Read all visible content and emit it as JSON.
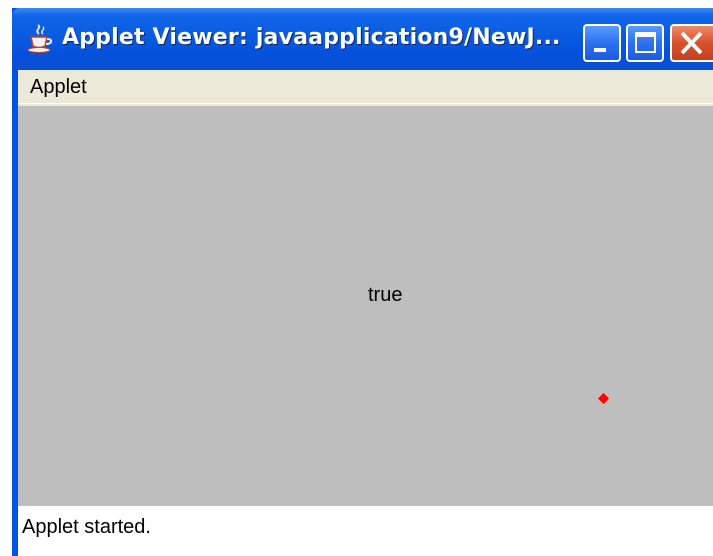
{
  "window": {
    "title": "Applet Viewer: javaapplication9/NewJ...",
    "icon": "java-cup-icon",
    "controls": {
      "minimize": "minimize-icon",
      "maximize": "maximize-icon",
      "close": "close-icon"
    }
  },
  "menubar": {
    "items": [
      {
        "label": "Applet"
      }
    ]
  },
  "applet": {
    "text": "true",
    "background": "#bebebe",
    "marker_color": "#ff0000"
  },
  "status": {
    "text": "Applet started."
  },
  "colors": {
    "titlebar": "#0a5be0",
    "close_button": "#d8512a",
    "menubar": "#ece9d8",
    "statusbar": "#ffffff"
  }
}
